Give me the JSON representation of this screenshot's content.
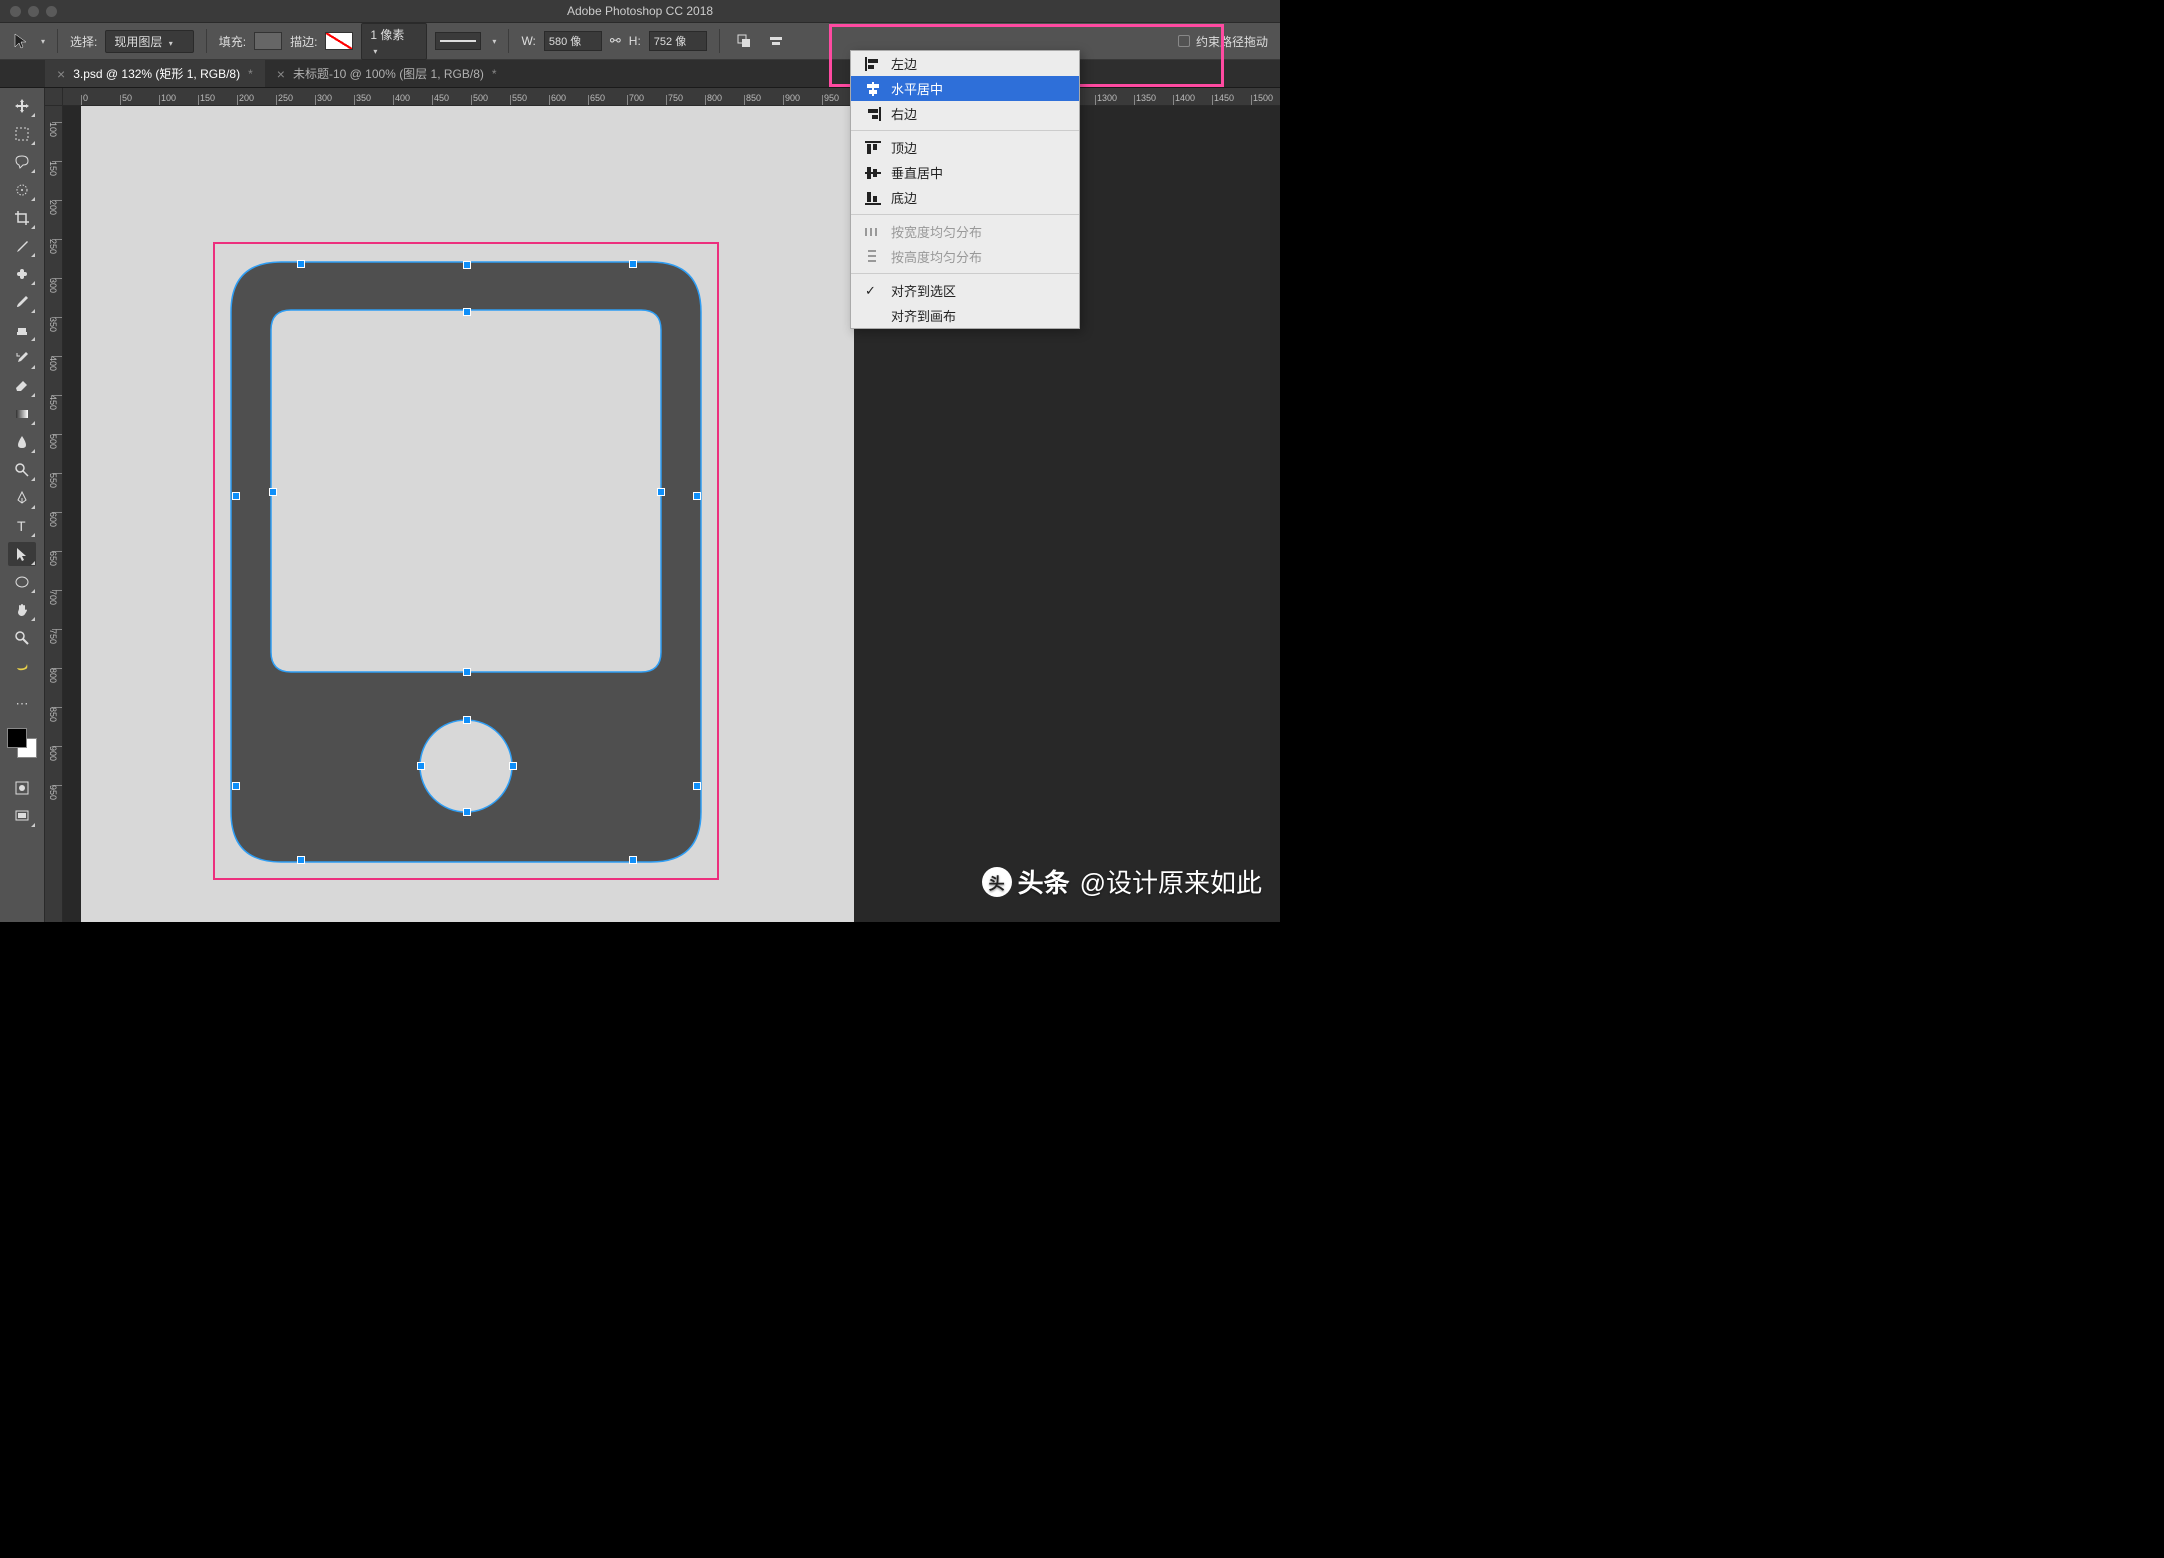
{
  "app_title": "Adobe Photoshop CC 2018",
  "options_bar": {
    "select_label": "选择:",
    "select_value": "现用图层",
    "fill_label": "填充:",
    "stroke_label": "描边:",
    "stroke_width": "1 像素",
    "W_label": "W:",
    "W_value": "580 像",
    "H_label": "H:",
    "H_value": "752 像",
    "constrain_label": "约束路径拖动"
  },
  "tabs": [
    {
      "name": "3.psd @ 132% (矩形 1, RGB/8)",
      "dirty": "*",
      "active": true
    },
    {
      "name": "未标题-10 @ 100% (图层 1, RGB/8)",
      "dirty": "*",
      "active": false
    }
  ],
  "align_menu": {
    "group1": [
      {
        "key": "left",
        "label": "左边"
      },
      {
        "key": "hcenter",
        "label": "水平居中",
        "highlighted": true
      },
      {
        "key": "right",
        "label": "右边"
      }
    ],
    "group2": [
      {
        "key": "top",
        "label": "顶边"
      },
      {
        "key": "vcenter",
        "label": "垂直居中"
      },
      {
        "key": "bottom",
        "label": "底边"
      }
    ],
    "group3": [
      {
        "key": "distw",
        "label": "按宽度均匀分布",
        "disabled": true
      },
      {
        "key": "disth",
        "label": "按高度均匀分布",
        "disabled": true
      }
    ],
    "group4": [
      {
        "key": "sel",
        "label": "对齐到选区",
        "checked": true
      },
      {
        "key": "canvas",
        "label": "对齐到画布"
      }
    ]
  },
  "ruler_h_ticks": [
    0,
    50,
    100,
    150,
    200,
    250,
    300,
    350,
    400,
    450,
    500,
    550,
    600,
    650,
    700,
    750,
    800,
    850,
    900,
    950,
    1300,
    1350,
    1400,
    1450,
    1500
  ],
  "ruler_v_ticks": [
    100,
    150,
    200,
    250,
    300,
    350,
    400,
    450,
    500,
    550,
    600,
    650,
    700,
    750,
    800,
    850,
    900,
    950
  ],
  "watermark": {
    "brand": "头条",
    "handle": "@设计原来如此"
  }
}
